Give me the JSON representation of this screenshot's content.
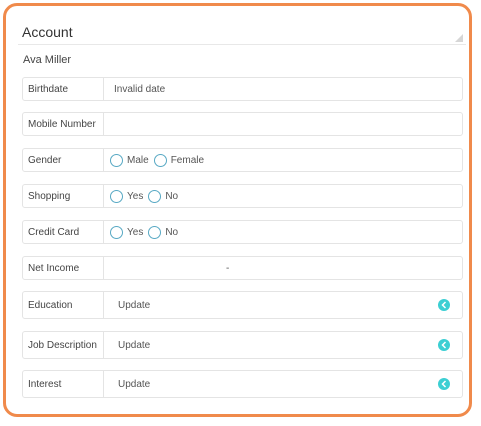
{
  "panel": {
    "title": "Account"
  },
  "user": {
    "name": "Ava Miller"
  },
  "fields": {
    "birthdate": {
      "label": "Birthdate",
      "value": "Invalid date"
    },
    "mobile": {
      "label": "Mobile Number",
      "value": ""
    },
    "gender": {
      "label": "Gender",
      "options": [
        "Male",
        "Female"
      ]
    },
    "shopping": {
      "label": "Shopping",
      "options": [
        "Yes",
        "No"
      ]
    },
    "credit_card": {
      "label": "Credit Card",
      "options": [
        "Yes",
        "No"
      ]
    },
    "net_income": {
      "label": "Net Income",
      "value": "-"
    },
    "education": {
      "label": "Education",
      "value": "Update"
    },
    "job_description": {
      "label": "Job Description",
      "value": "Update"
    },
    "interest": {
      "label": "Interest",
      "value": "Update"
    }
  },
  "icons": {
    "expand": "chevron-left-icon"
  },
  "colors": {
    "frame_border": "#f08a4b",
    "accent": "#3ccfd3",
    "radio_border": "#58a9c4"
  }
}
